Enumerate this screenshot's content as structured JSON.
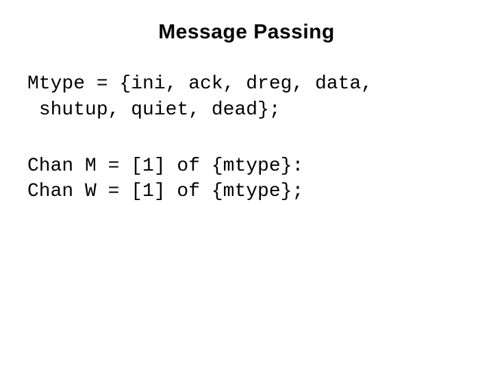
{
  "title": "Message Passing",
  "code": {
    "mtype_decl": "Mtype = {ini, ack, dreg, data,\n shutup, quiet, dead};",
    "chan_decl": "Chan M = [1] of {mtype}:\nChan W = [1] of {mtype};"
  }
}
